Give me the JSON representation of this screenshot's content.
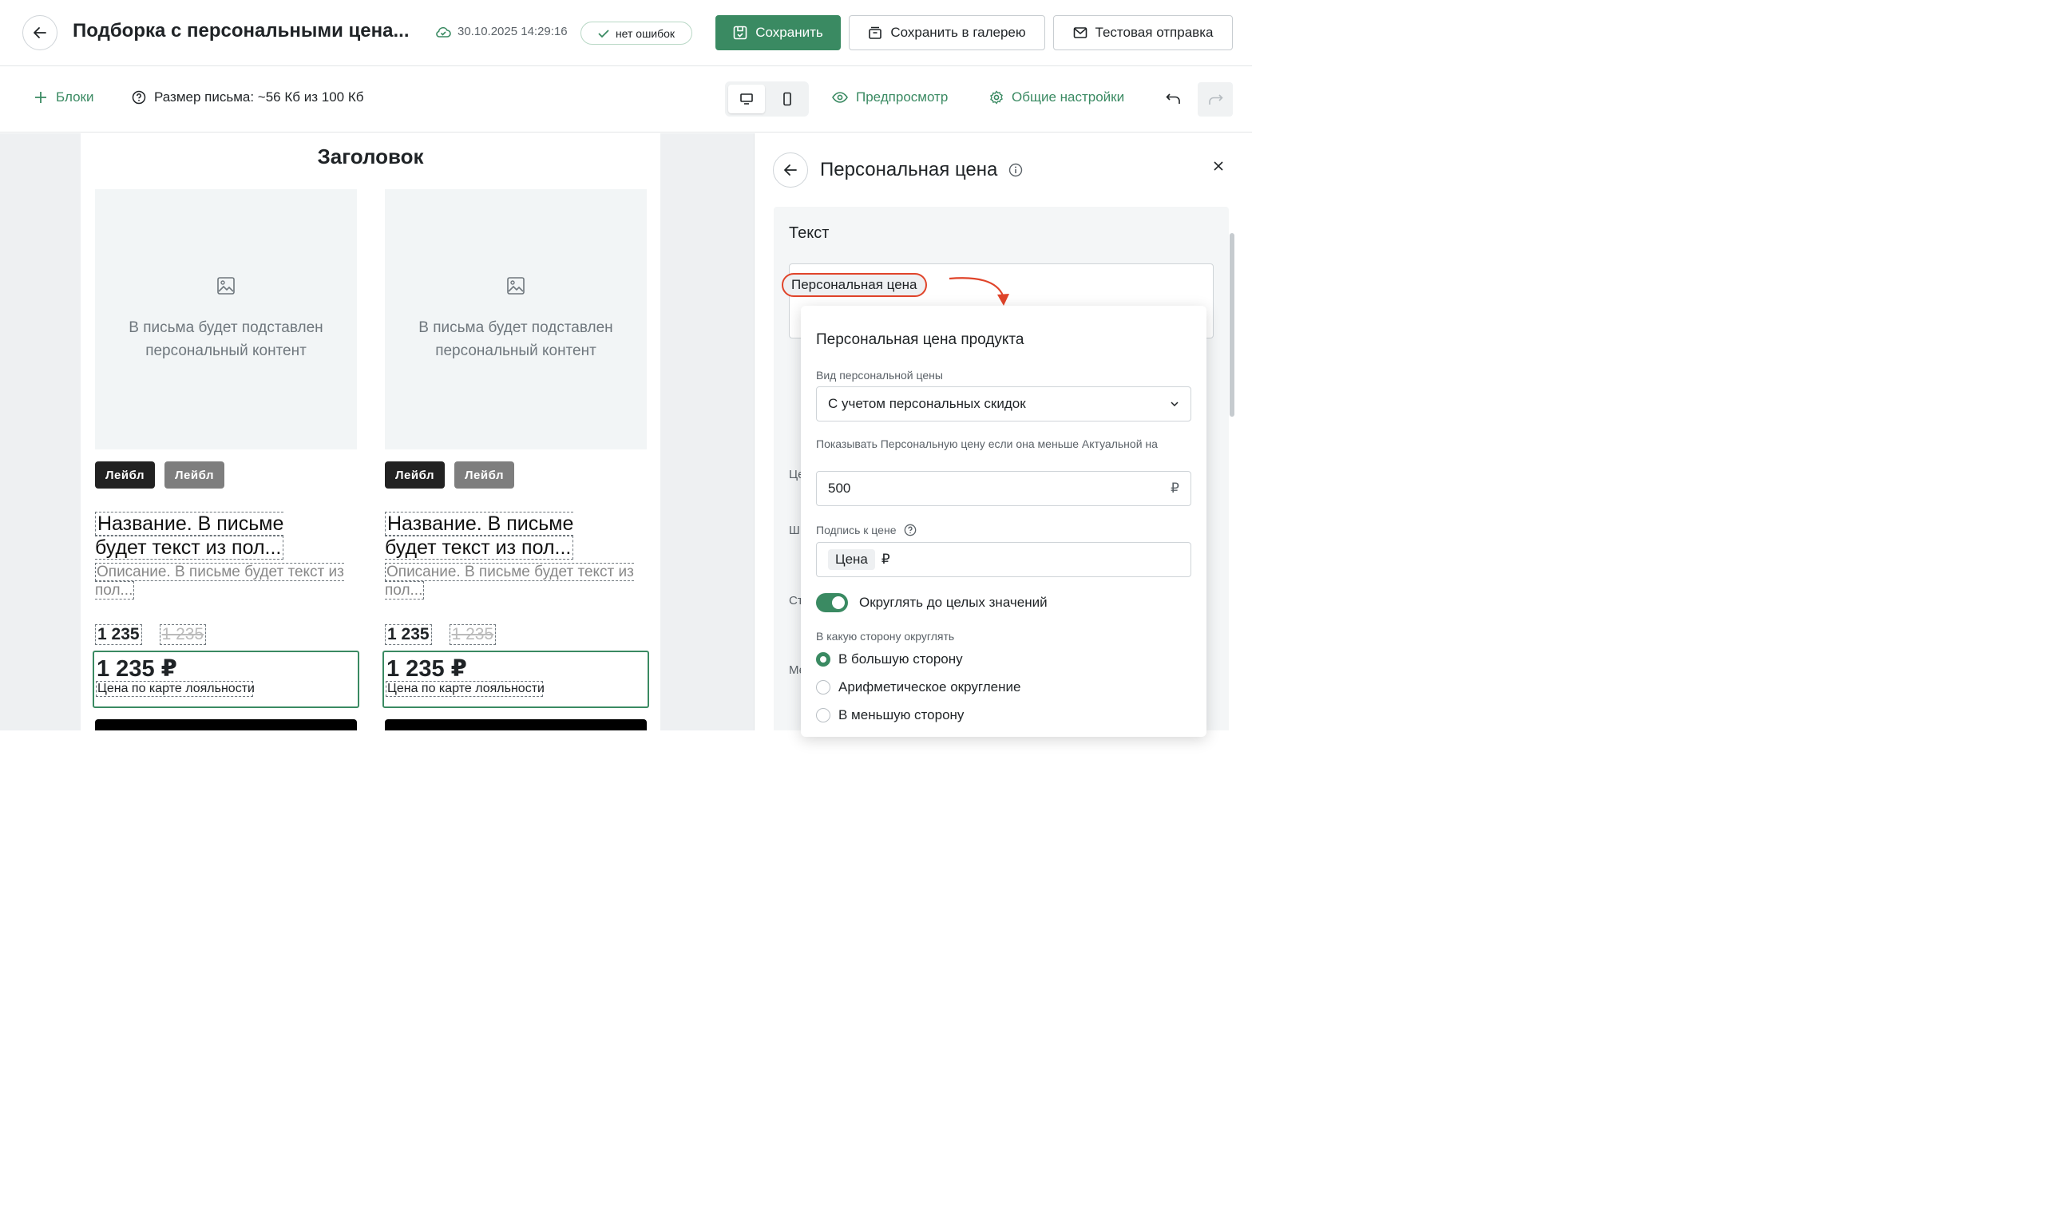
{
  "header": {
    "title": "Подборка с персональными цена...",
    "saved_at": "30.10.2025 14:29:16",
    "status_badge": "нет ошибок",
    "save_label": "Сохранить",
    "save_gallery_label": "Сохранить в галерею",
    "test_send_label": "Тестовая отправка"
  },
  "toolbar": {
    "blocks_label": "Блоки",
    "size_label": "Размер письма: ~56 Кб из 100 Кб",
    "preview_label": "Предпросмотр",
    "settings_label": "Общие настройки"
  },
  "email": {
    "heading": "Заголовок",
    "products": [
      {
        "placeholder_text": "В письма будет подставлен персональный контент",
        "label_1": "Лейбл",
        "label_2": "Лейбл",
        "name": "Название. В письме будет текст из пол...",
        "description": "Описание. В письме будет текст из пол...",
        "price": "1 235",
        "old_price": "1 235",
        "personal_price": "1 235 ₽",
        "personal_caption": "Цена по карте лояльности"
      },
      {
        "placeholder_text": "В письма будет подставлен персональный контент",
        "label_1": "Лейбл",
        "label_2": "Лейбл",
        "name": "Название. В письме будет текст из пол...",
        "description": "Описание. В письме будет текст из пол...",
        "price": "1 235",
        "old_price": "1 235",
        "personal_price": "1 235 ₽",
        "personal_caption": "Цена по карте лояльности"
      }
    ]
  },
  "panel": {
    "title": "Персональная цена",
    "section_title": "Текст",
    "chip": "Персональная цена",
    "side_fragments": [
      "Це",
      "Ш",
      "Ст",
      "Ме"
    ]
  },
  "popover": {
    "title": "Персональная цена продукта",
    "type_label": "Вид персональной цены",
    "type_value": "С учетом персональных скидок",
    "threshold_label": "Показывать Персональную цену если она меньше Актуальной на",
    "threshold_value": "500",
    "currency": "₽",
    "caption_label": "Подпись к цене",
    "caption_token": "Цена",
    "round_label": "Округлять до целых значений",
    "round_on": true,
    "direction_label": "В какую сторону округлять",
    "options": [
      "В большую сторону",
      "Арифметическое округление",
      "В меньшую сторону"
    ],
    "selected_option": 0
  },
  "colors": {
    "accent": "#3a8a62",
    "highlight": "#e0442a"
  }
}
